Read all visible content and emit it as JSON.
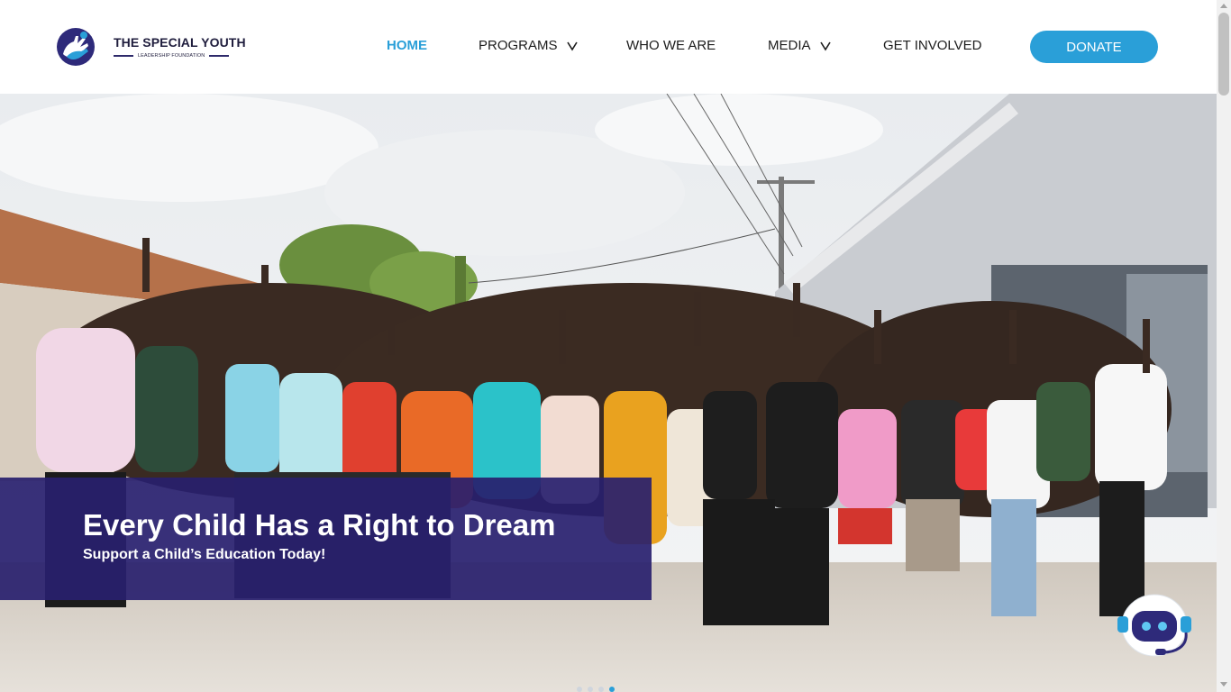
{
  "brand": {
    "title": "THE SPECIAL YOUTH",
    "subtitle": "LEADERSHIP FOUNDATION",
    "logo_icon": "hands-icon"
  },
  "nav": {
    "items": [
      {
        "label": "HOME",
        "active": true,
        "dropdown": false
      },
      {
        "label": "PROGRAMS",
        "active": false,
        "dropdown": true
      },
      {
        "label": "WHO WE ARE",
        "active": false,
        "dropdown": false
      },
      {
        "label": "MEDIA",
        "active": false,
        "dropdown": true
      },
      {
        "label": "GET INVOLVED",
        "active": false,
        "dropdown": false
      }
    ],
    "donate_label": "DONATE"
  },
  "hero": {
    "title": "Every Child Has a Right to Dream",
    "subtitle": "Support a Child’s Education Today!",
    "slides": 4,
    "active_slide": 4
  },
  "chatbot": {
    "icon": "robot-icon"
  },
  "colors": {
    "accent": "#2a9fd8",
    "brand_navy": "#281f6e",
    "text": "#1c1c1c"
  }
}
